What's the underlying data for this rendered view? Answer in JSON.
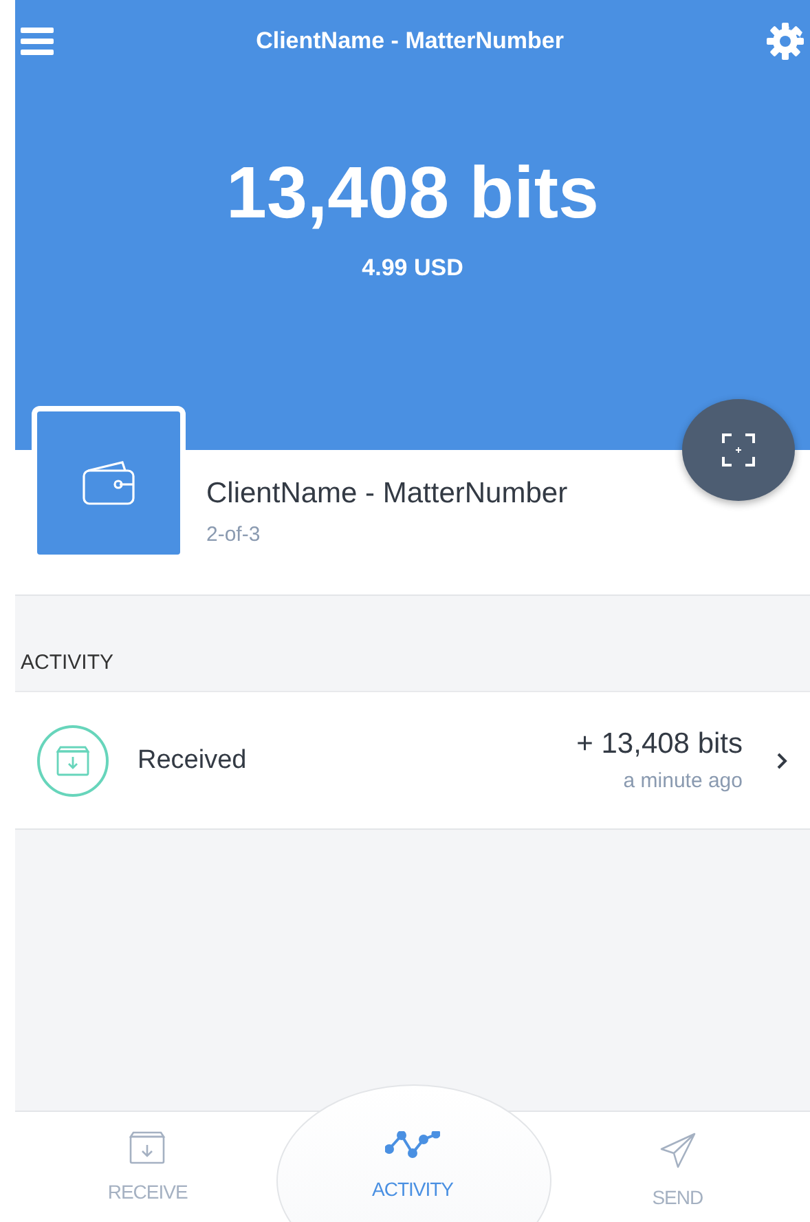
{
  "header": {
    "title": "ClientName - MatterNumber",
    "balance": "13,408 bits",
    "fiat": "4.99 USD"
  },
  "wallet": {
    "name": "ClientName - MatterNumber",
    "type": "2-of-3"
  },
  "activity": {
    "heading": "ACTIVITY",
    "items": [
      {
        "label": "Received",
        "amount": "+ 13,408 bits",
        "time": "a minute ago"
      }
    ]
  },
  "tabs": [
    {
      "kind": "receive",
      "label": "RECEIVE",
      "selected": false
    },
    {
      "kind": "activity",
      "label": "ACTIVITY",
      "selected": true
    },
    {
      "kind": "send",
      "label": "SEND",
      "selected": false
    }
  ]
}
